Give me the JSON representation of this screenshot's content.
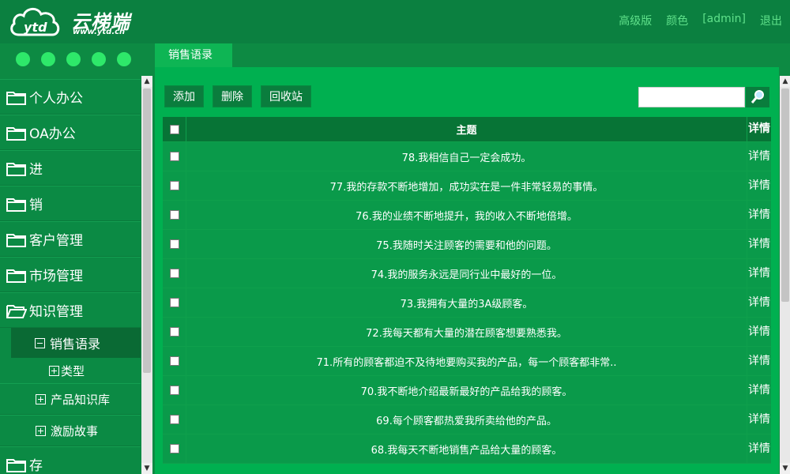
{
  "logo": {
    "text": "云梯端",
    "url": "www.ytd.cn"
  },
  "topnav": [
    "高级版",
    "颜色",
    "[admin]",
    "退出"
  ],
  "sidebar": {
    "items": [
      {
        "label": "个人办公",
        "open": false
      },
      {
        "label": "OA办公",
        "open": false
      },
      {
        "label": "进",
        "open": false
      },
      {
        "label": "销",
        "open": false
      },
      {
        "label": "客户管理",
        "open": false
      },
      {
        "label": "市场管理",
        "open": false
      },
      {
        "label": "知识管理",
        "open": true
      }
    ],
    "active_sub": "销售语录",
    "active_child": "类型",
    "subs": [
      "产品知识库",
      "激励故事"
    ],
    "next_item": "存"
  },
  "tab": {
    "label": "销售语录"
  },
  "toolbar": {
    "add": "添加",
    "delete": "删除",
    "recycle": "回收站"
  },
  "search": {
    "value": ""
  },
  "table": {
    "headers": {
      "title": "主题",
      "detail": "详情"
    },
    "rows": [
      "78.我相信自己一定会成功。",
      "77.我的存款不断地增加，成功实在是一件非常轻易的事情。",
      "76.我的业绩不断地提升，我的收入不断地倍增。",
      "75.我随时关注顾客的需要和他的问题。",
      "74.我的服务永远是同行业中最好的一位。",
      "73.我拥有大量的3A级顾客。",
      "72.我每天都有大量的潜在顾客想要熟悉我。",
      "71.所有的顾客都迫不及待地要购买我的产品，每一个顾客都非常..",
      "70.我不断地介绍最新最好的产品给我的顾客。",
      "69.每个顾客都热爱我所卖给他的产品。",
      "68.我每天不断地销售产品给大量的顾客。"
    ],
    "detail_label": "详情"
  },
  "colors": {
    "accent": "#00b050",
    "header": "#0b8040",
    "nav_link": "#5fe08a"
  }
}
